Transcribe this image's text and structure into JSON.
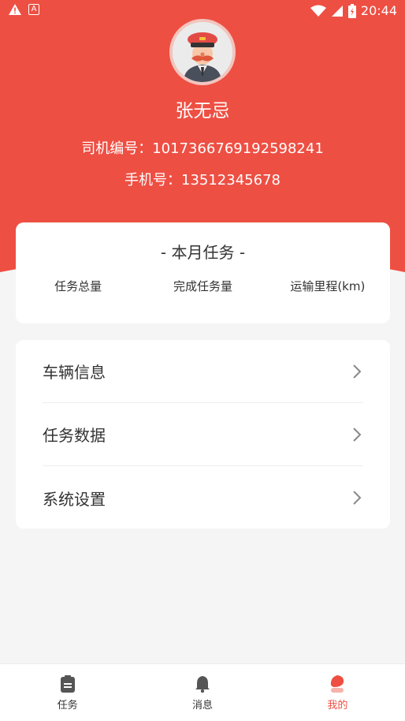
{
  "status_bar": {
    "time": "20:44"
  },
  "profile": {
    "name": "张无忌",
    "driver_id": "司机编号：1017366769192598241",
    "phone": "手机号：13512345678"
  },
  "monthly_task": {
    "title": "- 本月任务 -",
    "stats": [
      "任务总量",
      "完成任务量",
      "运输里程(km)"
    ]
  },
  "menu": {
    "items": [
      "车辆信息",
      "任务数据",
      "系统设置"
    ]
  },
  "tabbar": {
    "tabs": [
      "任务",
      "消息",
      "我的"
    ],
    "active": "我的"
  },
  "colors": {
    "accent": "#ee4f43",
    "background": "#f5f5f5"
  }
}
